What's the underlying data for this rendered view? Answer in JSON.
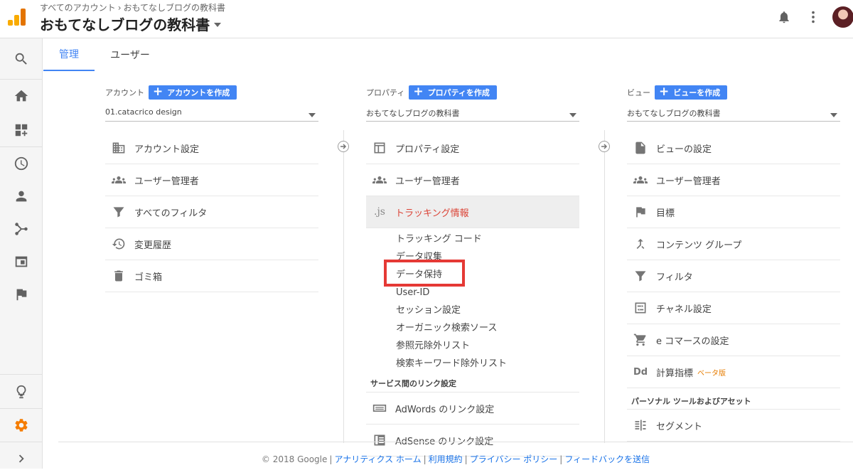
{
  "header": {
    "breadcrumb_root": "すべてのアカウント",
    "breadcrumb_sep": "›",
    "breadcrumb_current": "おもてなしブログの教科書",
    "property_title": "おもてなしブログの教科書"
  },
  "tabs": {
    "admin": "管理",
    "user": "ユーザー"
  },
  "account": {
    "label": "アカウント",
    "create_label": "アカウントを作成",
    "selected": "01.catacrico design",
    "items": [
      "アカウント設定",
      "ユーザー管理者",
      "すべてのフィルタ",
      "変更履歴",
      "ゴミ箱"
    ]
  },
  "property": {
    "label": "プロパティ",
    "create_label": "プロパティを作成",
    "selected": "おもてなしブログの教科書",
    "items": [
      "プロパティ設定",
      "ユーザー管理者"
    ],
    "tracking": {
      "icon_text": ".js",
      "label": "トラッキング情報",
      "subitems": [
        "トラッキング コード",
        "データ収集",
        "データ保持",
        "User-ID",
        "セッション設定",
        "オーガニック検索ソース",
        "参照元除外リスト",
        "検索キーワード除外リスト"
      ]
    },
    "links_heading": "サービス間のリンク設定",
    "link_items": [
      "AdWords のリンク設定",
      "AdSense のリンク設定"
    ]
  },
  "view": {
    "label": "ビュー",
    "create_label": "ビューを作成",
    "selected": "おもてなしブログの教科書",
    "items": [
      "ビューの設定",
      "ユーザー管理者",
      "目標",
      "コンテンツ グループ",
      "フィルタ",
      "チャネル設定",
      "e コマースの設定",
      "計算指標"
    ],
    "calc_icon_text": "Dd",
    "beta_label": "ベータ版",
    "personal_heading": "パーソナル ツールおよびアセット",
    "segment_label": "セグメント"
  },
  "footer": {
    "copyright": "© 2018 Google",
    "links": [
      "アナリティクス ホーム",
      "利用規約",
      "プライバシー ポリシー",
      "フィードバックを送信"
    ]
  },
  "colors": {
    "accent": "#4285f4",
    "active_text": "#db4437",
    "highlight": "#e53935",
    "settings_orange": "#f57c00",
    "beta": "#e67c00"
  }
}
